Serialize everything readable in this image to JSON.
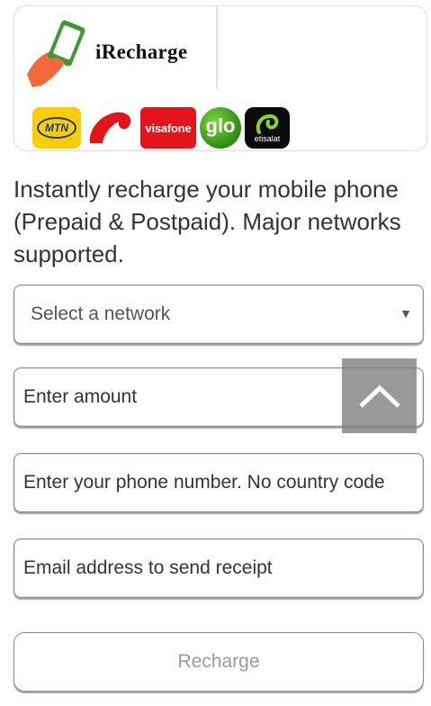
{
  "header": {
    "brand_name": "iRecharge",
    "networks": [
      {
        "name": "MTN",
        "label": "MTN",
        "color": "#ffcc00"
      },
      {
        "name": "Airtel",
        "label": "",
        "color": "#e4141b"
      },
      {
        "name": "Visafone",
        "label": "visafone",
        "color": "#e4141b"
      },
      {
        "name": "Glo",
        "label": "glo",
        "color": "#3a9a1a"
      },
      {
        "name": "Etisalat",
        "label": "etisalat",
        "color": "#0a0a0a"
      }
    ]
  },
  "description": "Instantly recharge your mobile phone (Prepaid & Postpaid). Major networks supported.",
  "form": {
    "network_select": {
      "selected": "Select a network",
      "arrow_icon": "triangle-down-icon"
    },
    "amount": {
      "placeholder": "Enter amount"
    },
    "phone": {
      "placeholder": "Enter your phone number. No country code"
    },
    "email": {
      "placeholder": "Email address to send receipt"
    },
    "submit_label": "Recharge"
  },
  "scroll_top": {
    "icon": "chevron-up-icon"
  }
}
